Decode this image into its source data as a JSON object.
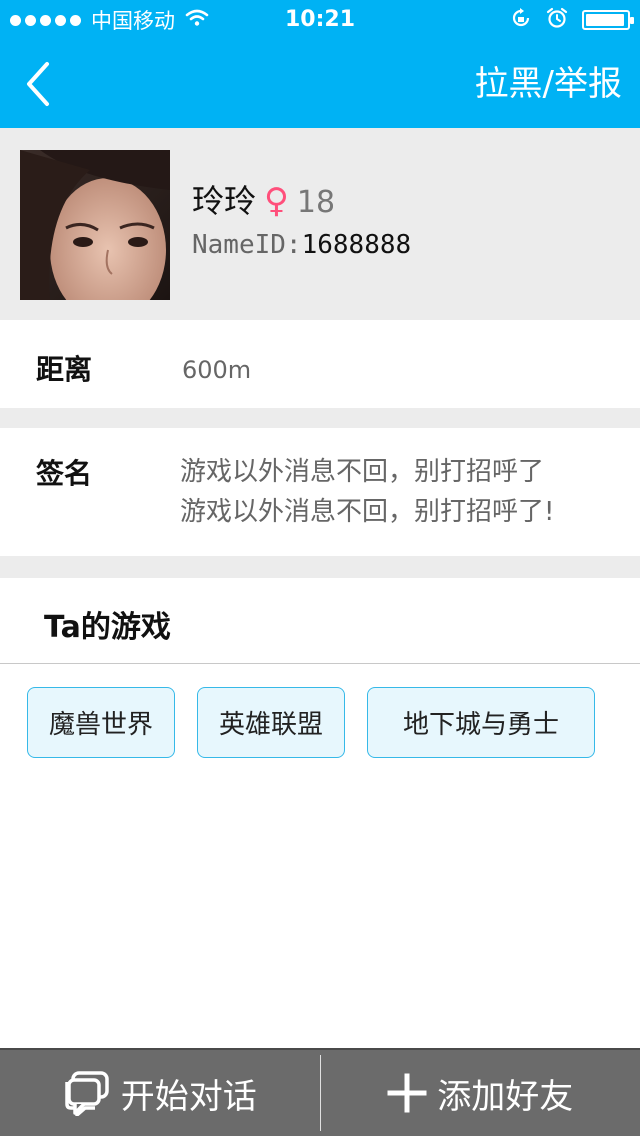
{
  "status_bar": {
    "carrier": "中国移动",
    "time": "10:21",
    "battery_level": 0.95
  },
  "nav": {
    "back_icon": "chevron-left-icon",
    "action_label": "拉黑/举报"
  },
  "profile": {
    "name": "玲玲",
    "gender_symbol": "♀",
    "age": "18",
    "nameid_label": "NameID:",
    "nameid_value": "1688888"
  },
  "distance": {
    "label": "距离",
    "value": "600m"
  },
  "signature": {
    "label": "签名",
    "line1": "游戏以外消息不回，别打招呼了",
    "line2": "游戏以外消息不回，别打招呼了!"
  },
  "games": {
    "title": "Ta的游戏",
    "tags": [
      "魔兽世界",
      "英雄联盟",
      "地下城与勇士"
    ]
  },
  "bottom_bar": {
    "chat_label": "开始对话",
    "add_label": "添加好友"
  },
  "colors": {
    "brand": "#00b2f4",
    "tag_border": "#36b9e8",
    "gender_female": "#ff4f7b"
  }
}
